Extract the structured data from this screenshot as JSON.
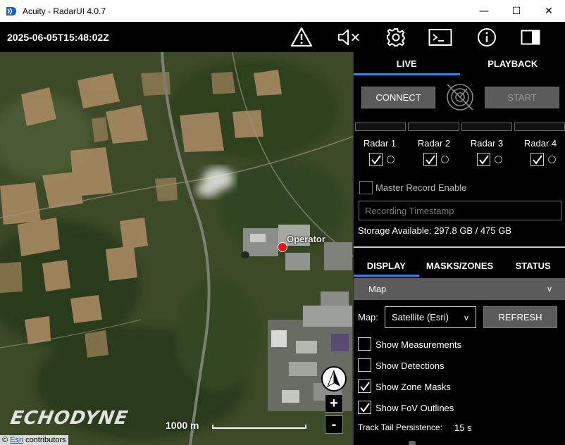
{
  "window": {
    "title": "Acuity - RadarUI 4.0.7",
    "controls": {
      "minimize": "—",
      "maximize": "☐",
      "close": "✕"
    }
  },
  "header": {
    "timestamp": "2025-06-05T15:48:02Z",
    "icons": [
      "warning-icon",
      "speaker-muted-icon",
      "gear-icon",
      "terminal-icon",
      "info-icon",
      "panel-toggle-icon"
    ]
  },
  "map": {
    "marker_label": "Operator",
    "scale_label": "1000 m",
    "zoom_in": "+",
    "zoom_out": "-",
    "logo_text": "ECHODYNE",
    "attribution": {
      "copyright": "©",
      "provider": "Esri",
      "suffix": "contributors"
    }
  },
  "panel": {
    "top_tabs": [
      {
        "label": "LIVE",
        "active": true
      },
      {
        "label": "PLAYBACK",
        "active": false
      }
    ],
    "connect_label": "CONNECT",
    "start_label": "START",
    "radars": [
      {
        "label": "Radar 1",
        "checked": true
      },
      {
        "label": "Radar 2",
        "checked": true
      },
      {
        "label": "Radar 3",
        "checked": true
      },
      {
        "label": "Radar 4",
        "checked": true
      }
    ],
    "master_record_label": "Master Record Enable",
    "master_record_checked": false,
    "timestamp_placeholder": "Recording Timestamp",
    "storage_text": "Storage Available: 297.8 GB / 475 GB",
    "bottom_tabs": [
      {
        "label": "DISPLAY",
        "active": true
      },
      {
        "label": "MASKS/ZONES",
        "active": false
      },
      {
        "label": "STATUS",
        "active": false
      }
    ],
    "section_title": "Map",
    "section_chevron": "v",
    "map_label": "Map:",
    "map_select_value": "Satellite (Esri)",
    "select_chevron": "v",
    "refresh_label": "REFRESH",
    "options": [
      {
        "label": "Show Measurements",
        "checked": false
      },
      {
        "label": "Show Detections",
        "checked": false
      },
      {
        "label": "Show Zone Masks",
        "checked": true
      },
      {
        "label": "Show FoV Outlines",
        "checked": true
      }
    ],
    "track_tail_label": "Track Tail Persistence:",
    "track_tail_value": "15 s"
  },
  "colors": {
    "accent": "#2d86e6",
    "button_gray": "#5a5a5a",
    "operator_marker": "#ee1111"
  }
}
